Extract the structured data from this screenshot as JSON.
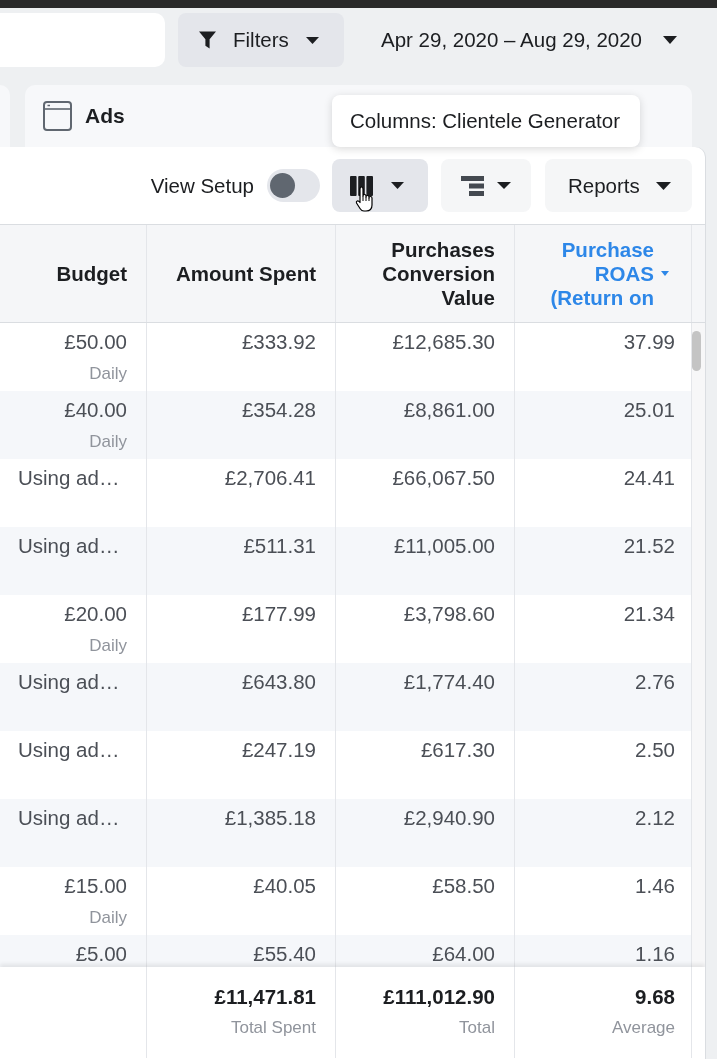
{
  "filters_button": {
    "label": "Filters"
  },
  "date_range": {
    "label": "Apr 29, 2020 – Aug 29, 2020"
  },
  "level_tab": {
    "label": "Ads"
  },
  "tooltip": {
    "text": "Columns: Clientele Generator"
  },
  "toolbar": {
    "view_setup": {
      "label": "View Setup",
      "on": false
    },
    "columns_button": {
      "hovered": true
    },
    "reports_button": {
      "label": "Reports"
    }
  },
  "table": {
    "columns": [
      {
        "label": "Budget",
        "sorted": false
      },
      {
        "label": "Amount Spent",
        "sorted": false
      },
      {
        "label": "Purchases Conversion Value",
        "sorted": false
      },
      {
        "label": "Purchase ROAS (Return on",
        "sorted": true
      }
    ],
    "rows": [
      {
        "budget": {
          "kind": "amount",
          "value": "£50.00",
          "period": "Daily"
        },
        "amount_spent": "£333.92",
        "conversion_value": "£12,685.30",
        "roas": "37.99"
      },
      {
        "budget": {
          "kind": "amount",
          "value": "£40.00",
          "period": "Daily"
        },
        "amount_spent": "£354.28",
        "conversion_value": "£8,861.00",
        "roas": "25.01"
      },
      {
        "budget": {
          "kind": "note",
          "value": "Using ad…"
        },
        "amount_spent": "£2,706.41",
        "conversion_value": "£66,067.50",
        "roas": "24.41"
      },
      {
        "budget": {
          "kind": "note",
          "value": "Using ad…"
        },
        "amount_spent": "£511.31",
        "conversion_value": "£11,005.00",
        "roas": "21.52"
      },
      {
        "budget": {
          "kind": "amount",
          "value": "£20.00",
          "period": "Daily"
        },
        "amount_spent": "£177.99",
        "conversion_value": "£3,798.60",
        "roas": "21.34"
      },
      {
        "budget": {
          "kind": "note",
          "value": "Using ad…"
        },
        "amount_spent": "£643.80",
        "conversion_value": "£1,774.40",
        "roas": "2.76"
      },
      {
        "budget": {
          "kind": "note",
          "value": "Using ad…"
        },
        "amount_spent": "£247.19",
        "conversion_value": "£617.30",
        "roas": "2.50"
      },
      {
        "budget": {
          "kind": "note",
          "value": "Using ad…"
        },
        "amount_spent": "£1,385.18",
        "conversion_value": "£2,940.90",
        "roas": "2.12"
      },
      {
        "budget": {
          "kind": "amount",
          "value": "£15.00",
          "period": "Daily"
        },
        "amount_spent": "£40.05",
        "conversion_value": "£58.50",
        "roas": "1.46"
      },
      {
        "budget": {
          "kind": "amount",
          "value": "£5.00"
        },
        "amount_spent": "£55.40",
        "conversion_value": "£64.00",
        "roas": "1.16"
      }
    ],
    "totals": {
      "amount_spent": {
        "value": "£11,471.81",
        "label": "Total Spent"
      },
      "conversion_value": {
        "value": "£111,012.90",
        "label": "Total"
      },
      "roas": {
        "value": "9.68",
        "label": "Average"
      }
    }
  }
}
